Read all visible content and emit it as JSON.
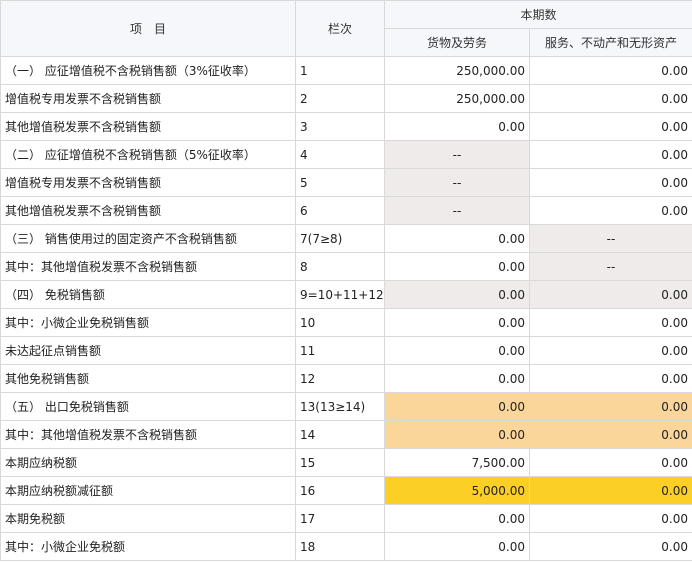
{
  "table": {
    "header": {
      "item": "项　目",
      "column_no": "栏次",
      "current_period": "本期数",
      "goods": "货物及劳务",
      "services": "服务、不动产和无形资产"
    },
    "rows": [
      {
        "item": "（一）  应征增值税不含税销售额（3%征收率）",
        "code": "1",
        "goods": "250,000.00",
        "services": "0.00"
      },
      {
        "item": "增值税专用发票不含税销售额",
        "code": "2",
        "goods": "250,000.00",
        "services": "0.00"
      },
      {
        "item": "其他增值税发票不含税销售额",
        "code": "3",
        "goods": "0.00",
        "services": "0.00"
      },
      {
        "item": "（二）  应征增值税不含税销售额（5%征收率）",
        "code": "4",
        "goods": "--",
        "services": "0.00"
      },
      {
        "item": "增值税专用发票不含税销售额",
        "code": "5",
        "goods": "--",
        "services": "0.00"
      },
      {
        "item": "其他增值税发票不含税销售额",
        "code": "6",
        "goods": "--",
        "services": "0.00"
      },
      {
        "item": "（三）  销售使用过的固定资产不含税销售额",
        "code": "7(7≥8)",
        "goods": "0.00",
        "services": "--"
      },
      {
        "item": "其中：其他增值税发票不含税销售额",
        "code": "8",
        "goods": "0.00",
        "services": "--"
      },
      {
        "item": "（四）  免税销售额",
        "code": "9=10+11+12",
        "goods": "0.00",
        "services": "0.00"
      },
      {
        "item": "其中：小微企业免税销售额",
        "code": "10",
        "goods": "0.00",
        "services": "0.00"
      },
      {
        "item": "未达起征点销售额",
        "code": "11",
        "goods": "0.00",
        "services": "0.00"
      },
      {
        "item": "其他免税销售额",
        "code": "12",
        "goods": "0.00",
        "services": "0.00"
      },
      {
        "item": "（五）  出口免税销售额",
        "code": "13(13≥14)",
        "goods": "0.00",
        "services": "0.00"
      },
      {
        "item": "其中：其他增值税发票不含税销售额",
        "code": "14",
        "goods": "0.00",
        "services": "0.00"
      },
      {
        "item": "本期应纳税额",
        "code": "15",
        "goods": "7,500.00",
        "services": "0.00"
      },
      {
        "item": "本期应纳税额减征额",
        "code": "16",
        "goods": "5,000.00",
        "services": "0.00"
      },
      {
        "item": "本期免税额",
        "code": "17",
        "goods": "0.00",
        "services": "0.00"
      },
      {
        "item": "其中：小微企业免税额",
        "code": "18",
        "goods": "0.00",
        "services": "0.00"
      }
    ]
  },
  "colors": {
    "header_bg": "#f5f7fa",
    "border": "#d9d9d9",
    "disabled_gray": "#efebea",
    "highlight_peach": "#fbd69b",
    "highlight_yellow": "#fbcf25"
  }
}
